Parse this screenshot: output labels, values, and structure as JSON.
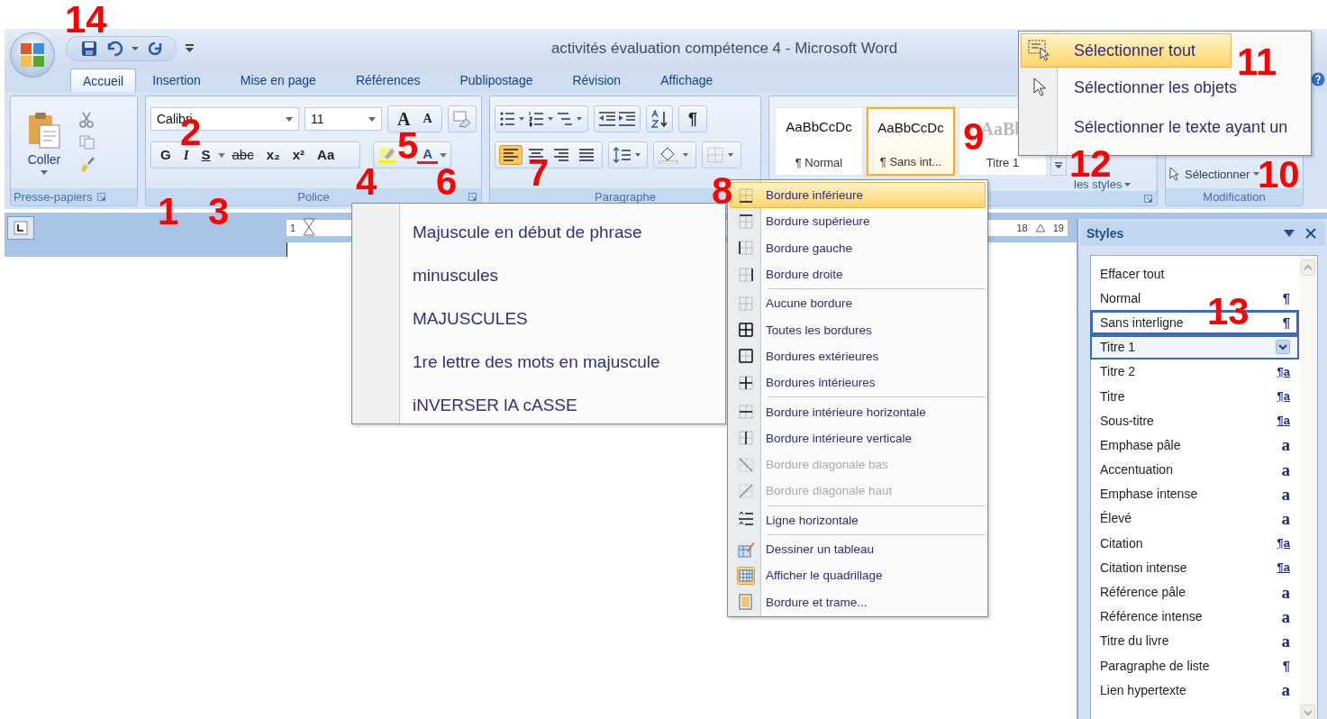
{
  "window": {
    "title": "activités évaluation compétence 4 - Microsoft Word"
  },
  "tabs": [
    {
      "label": "Accueil",
      "selected": true
    },
    {
      "label": "Insertion",
      "selected": false
    },
    {
      "label": "Mise en page",
      "selected": false
    },
    {
      "label": "Références",
      "selected": false
    },
    {
      "label": "Publipostage",
      "selected": false
    },
    {
      "label": "Révision",
      "selected": false
    },
    {
      "label": "Affichage",
      "selected": false
    }
  ],
  "clipboard": {
    "paste": "Coller",
    "group": "Presse-papiers"
  },
  "font": {
    "group": "Police",
    "font_name": "Calibri",
    "font_size": "11",
    "grow": "A",
    "shrink": "A",
    "bold": "G",
    "italic": "I",
    "underline": "S",
    "strike": "abc",
    "subscript": "x₂",
    "superscript": "x²",
    "change_case": "Aa",
    "font_color": "A"
  },
  "paragraph": {
    "group": "Paragraphe",
    "pilcrow": "¶",
    "alignments": [
      {
        "selected": true
      },
      {
        "selected": false
      },
      {
        "selected": false
      },
      {
        "selected": false
      }
    ]
  },
  "styles_gallery": {
    "items": [
      {
        "kind": "body",
        "preview": "AaBbCcDc",
        "label": "¶ Normal",
        "selected": false
      },
      {
        "kind": "body",
        "preview": "AaBbCcDc",
        "label": "¶ Sans int...",
        "selected": true
      },
      {
        "kind": "heading",
        "preview": "AaBb",
        "label": "Titre 1",
        "selected": false
      }
    ],
    "change_styles": "les styles"
  },
  "editing": {
    "group": "Modification",
    "select": "Sélectionner"
  },
  "ruler": [
    "1",
    "18",
    "19"
  ],
  "case_menu": {
    "items": [
      "Majuscule en début de phrase",
      "minuscules",
      "MAJUSCULES",
      "1re lettre des mots en majuscule",
      "iNVERSER lA cASSE"
    ]
  },
  "border_menu": {
    "sections": [
      [
        {
          "kind": "bottom",
          "label": "Bordure inférieure",
          "selected": true,
          "disabled": false,
          "checked": false
        },
        {
          "kind": "top",
          "label": "Bordure supérieure",
          "selected": false,
          "disabled": false,
          "checked": false
        },
        {
          "kind": "left",
          "label": "Bordure gauche",
          "selected": false,
          "disabled": false,
          "checked": false
        },
        {
          "kind": "right",
          "label": "Bordure droite",
          "selected": false,
          "disabled": false,
          "checked": false
        }
      ],
      [
        {
          "kind": "none",
          "label": "Aucune bordure",
          "selected": false,
          "disabled": false,
          "checked": false
        },
        {
          "kind": "all",
          "label": "Toutes les bordures",
          "selected": false,
          "disabled": false,
          "checked": false
        },
        {
          "kind": "outside",
          "label": "Bordures extérieures",
          "selected": false,
          "disabled": false,
          "checked": false
        },
        {
          "kind": "inside",
          "label": "Bordures intérieures",
          "selected": false,
          "disabled": false,
          "checked": false
        }
      ],
      [
        {
          "kind": "inside_h",
          "label": "Bordure intérieure horizontale",
          "selected": false,
          "disabled": false,
          "checked": false
        },
        {
          "kind": "inside_v",
          "label": "Bordure intérieure verticale",
          "selected": false,
          "disabled": false,
          "checked": false
        },
        {
          "kind": "diag_down",
          "label": "Bordure diagonale bas",
          "selected": false,
          "disabled": true,
          "checked": false
        },
        {
          "kind": "diag_up",
          "label": "Bordure diagonale haut",
          "selected": false,
          "disabled": true,
          "checked": false
        }
      ],
      [
        {
          "kind": "hline",
          "label": "Ligne horizontale",
          "selected": false,
          "disabled": false,
          "checked": false
        }
      ],
      [
        {
          "kind": "draw",
          "label": "Dessiner un tableau",
          "selected": false,
          "disabled": false,
          "checked": false
        },
        {
          "kind": "grid",
          "label": "Afficher le quadrillage",
          "selected": false,
          "disabled": false,
          "checked": true
        },
        {
          "kind": "shading",
          "label": "Bordure et trame...",
          "selected": false,
          "disabled": false,
          "checked": false
        }
      ]
    ]
  },
  "select_menu": {
    "items": [
      {
        "kind": "all",
        "label": "Sélectionner tout",
        "selected": true
      },
      {
        "kind": "objects",
        "label": "Sélectionner les objets",
        "selected": false
      },
      {
        "kind": "text",
        "label": "Sélectionner le texte ayant un",
        "selected": false
      }
    ]
  },
  "styles_pane": {
    "title": "Styles",
    "items": [
      {
        "name": "Effacer tout",
        "selected": false,
        "hovered": false
      },
      {
        "name": "Normal",
        "kind": "paragraph",
        "marker": "¶",
        "selected": false,
        "hovered": false
      },
      {
        "name": "Sans interligne",
        "kind": "paragraph",
        "marker": "¶",
        "selected": true,
        "hovered": false
      },
      {
        "name": "Titre 1",
        "selected": false,
        "hovered": true
      },
      {
        "name": "Titre 2",
        "kind": "linked",
        "marker": "¶a",
        "selected": false,
        "hovered": false
      },
      {
        "name": "Titre",
        "kind": "linked",
        "marker": "¶a",
        "selected": false,
        "hovered": false
      },
      {
        "name": "Sous-titre",
        "kind": "linked",
        "marker": "¶a",
        "selected": false,
        "hovered": false
      },
      {
        "name": "Emphase pâle",
        "kind": "character",
        "marker": "a",
        "selected": false,
        "hovered": false
      },
      {
        "name": "Accentuation",
        "kind": "character",
        "marker": "a",
        "selected": false,
        "hovered": false
      },
      {
        "name": "Emphase intense",
        "kind": "character",
        "marker": "a",
        "selected": false,
        "hovered": false
      },
      {
        "name": "Élevé",
        "kind": "character",
        "marker": "a",
        "selected": false,
        "hovered": false
      },
      {
        "name": "Citation",
        "kind": "linked",
        "marker": "¶a",
        "selected": false,
        "hovered": false
      },
      {
        "name": "Citation intense",
        "kind": "linked",
        "marker": "¶a",
        "selected": false,
        "hovered": false
      },
      {
        "name": "Référence pâle",
        "kind": "character",
        "marker": "a",
        "selected": false,
        "hovered": false
      },
      {
        "name": "Référence intense",
        "kind": "character",
        "marker": "a",
        "selected": false,
        "hovered": false
      },
      {
        "name": "Titre du livre",
        "kind": "character",
        "marker": "a",
        "selected": false,
        "hovered": false
      },
      {
        "name": "Paragraphe de liste",
        "kind": "paragraph",
        "marker": "¶",
        "selected": false,
        "hovered": false
      },
      {
        "name": "Lien hypertexte",
        "kind": "character",
        "marker": "a",
        "selected": false,
        "hovered": false
      }
    ]
  },
  "annotations": [
    "14",
    "11",
    "2",
    "5",
    "9",
    "12",
    "4",
    "6",
    "7",
    "10",
    "8",
    "1",
    "3",
    "13"
  ]
}
